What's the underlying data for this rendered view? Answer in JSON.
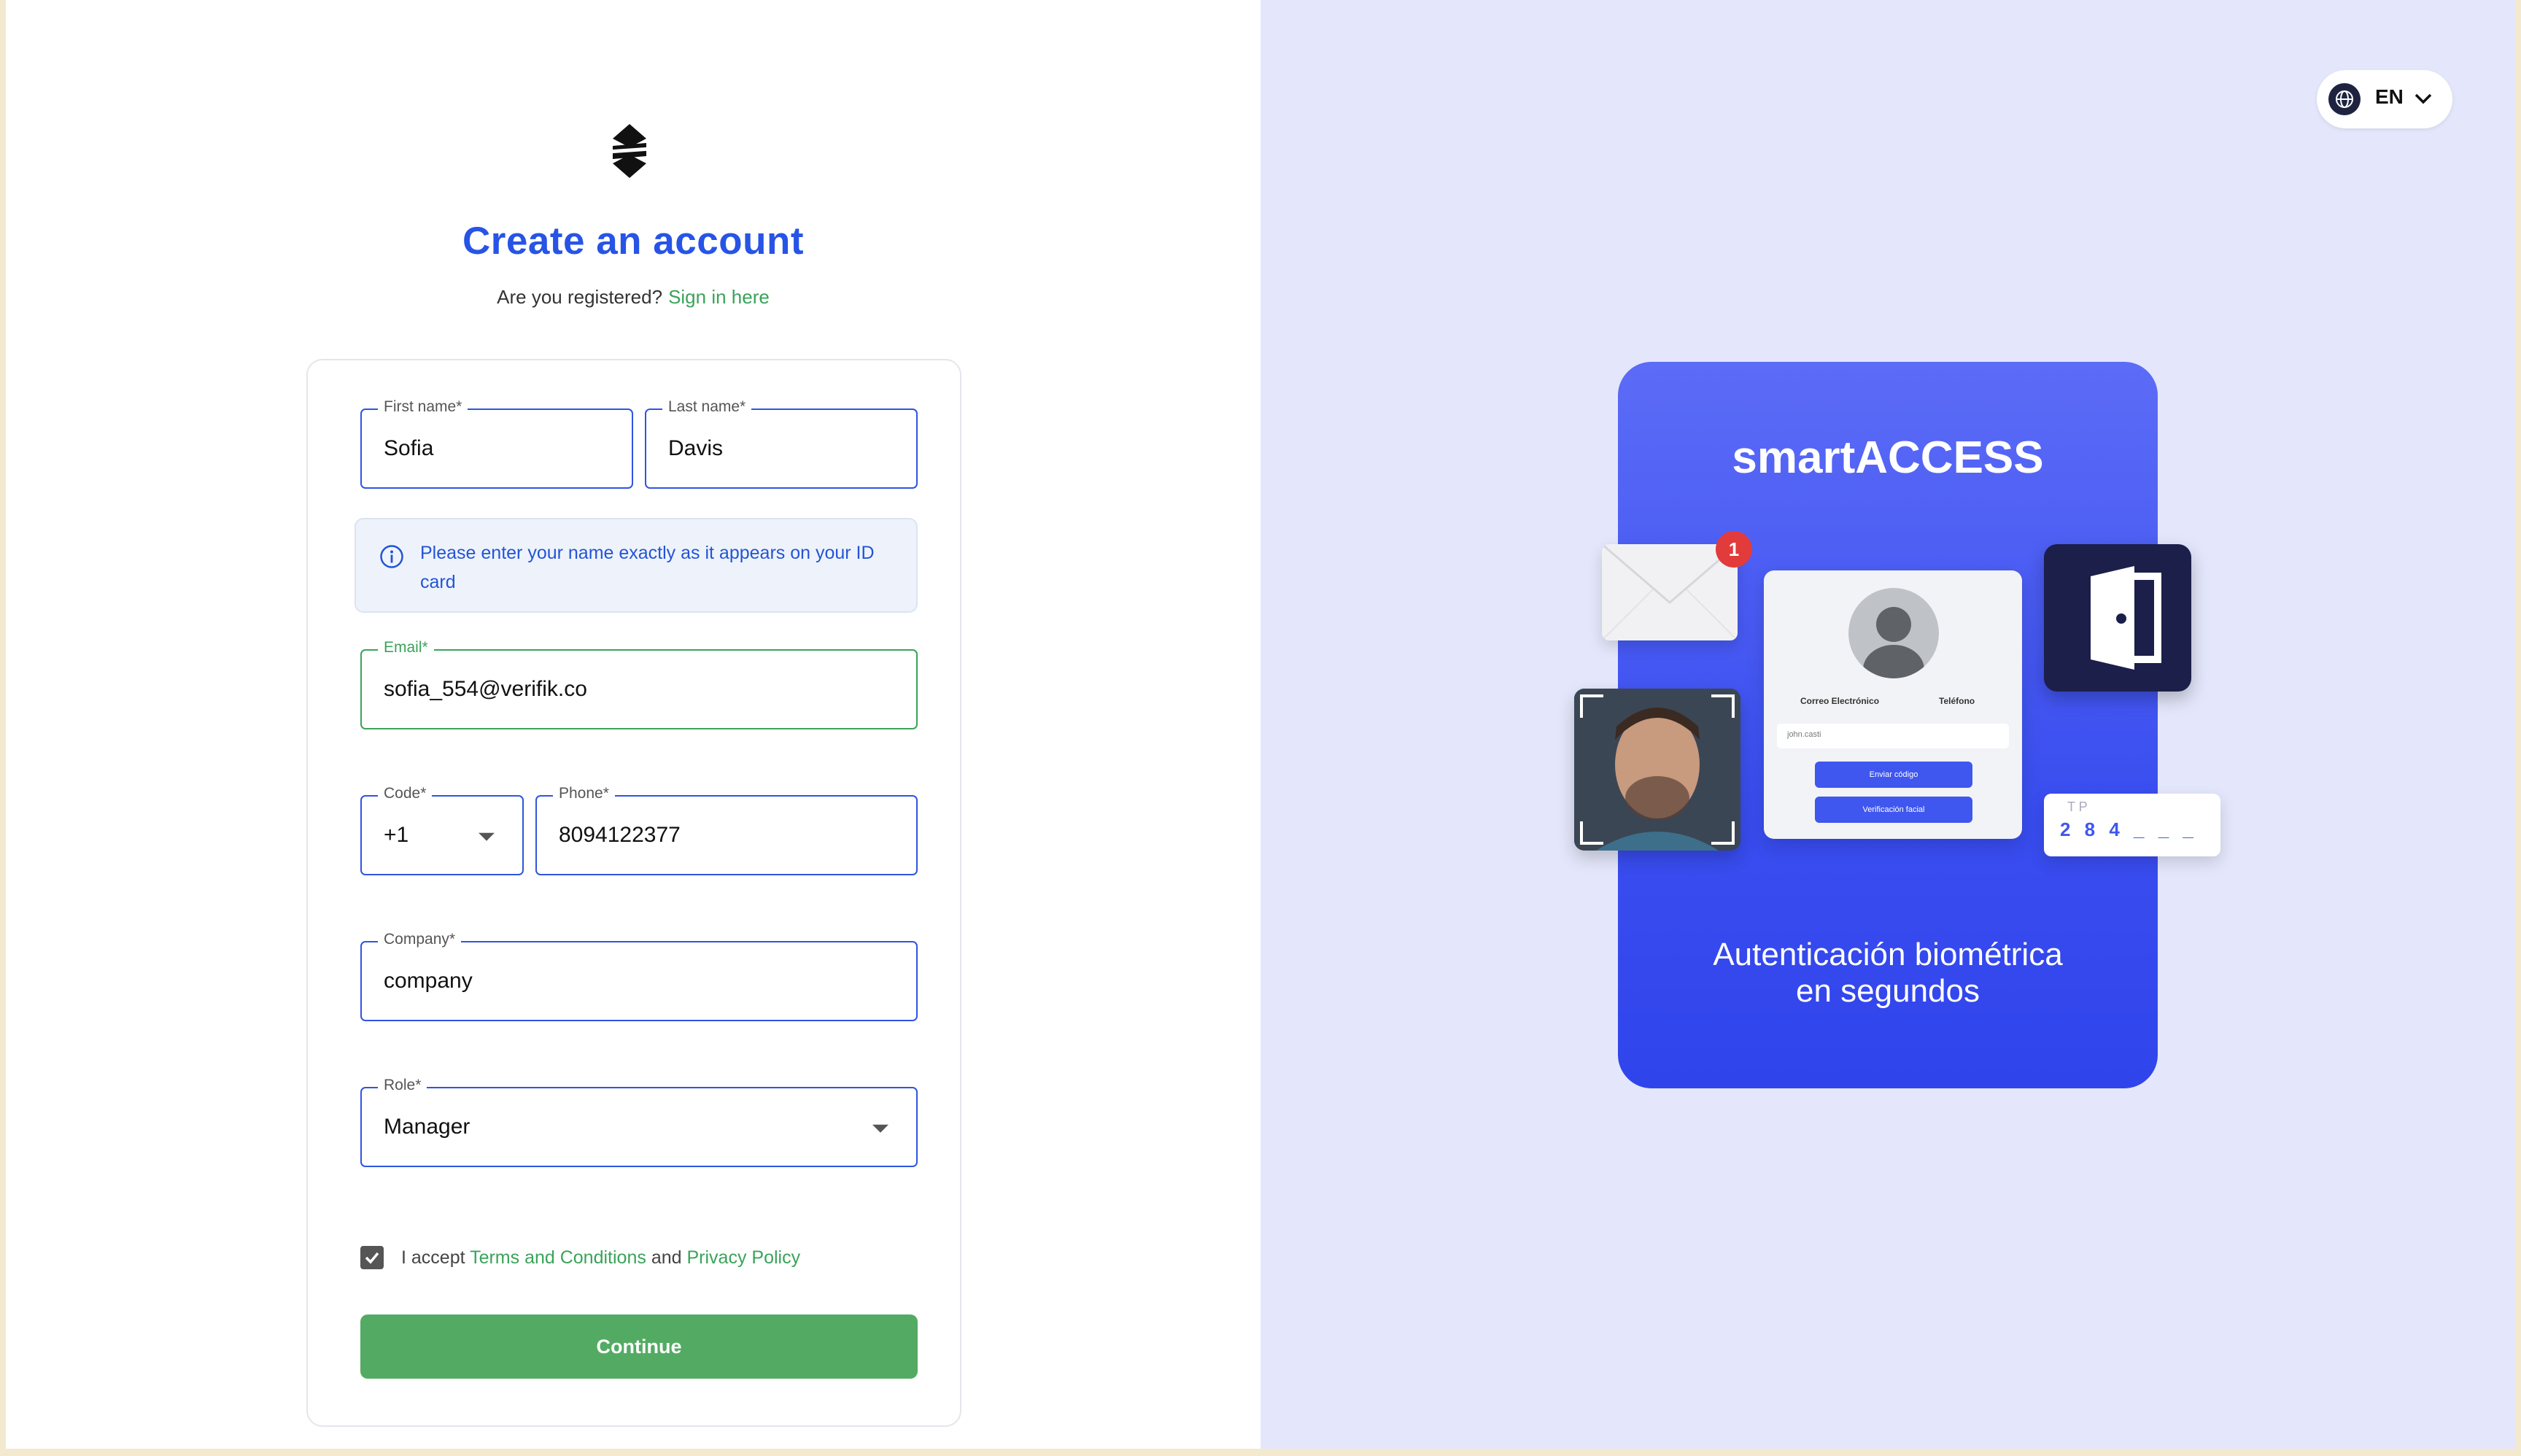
{
  "header": {
    "title": "Create an account",
    "registered_prompt": "Are you registered?",
    "sign_in_link": "Sign in here"
  },
  "form": {
    "first_name": {
      "label": "First name*",
      "value": "Sofia"
    },
    "last_name": {
      "label": "Last name*",
      "value": "Davis"
    },
    "info_text": "Please enter your name exactly as it appears on your ID card",
    "email": {
      "label": "Email*",
      "value": "sofia_554@verifik.co"
    },
    "code": {
      "label": "Code*",
      "value": "+1"
    },
    "phone": {
      "label": "Phone*",
      "value": "8094122377"
    },
    "company": {
      "label": "Company*",
      "value": "company"
    },
    "role": {
      "label": "Role*",
      "value": "Manager"
    },
    "terms": {
      "checked": true,
      "prefix": "I accept",
      "terms_link": "Terms and Conditions",
      "and_text": "and",
      "privacy_link": "Privacy Policy"
    },
    "continue_label": "Continue"
  },
  "language": {
    "code": "EN"
  },
  "promo": {
    "brand": "smartACCESS",
    "tagline_line1": "Autenticación biométrica",
    "tagline_line2": "en segundos",
    "notification_count": "1",
    "mock_email_label": "Correo Electrónico",
    "mock_phone_label": "Teléfono",
    "mock_input_value": "john.casti",
    "mock_send_code": "Enviar código",
    "mock_face_verify": "Verificación facial",
    "otp_digits": "2 8 4 _ _ _",
    "otp_top": "T P"
  },
  "colors": {
    "accent_blue": "#2754e6",
    "link_green": "#3aa35a",
    "button_green": "#53ab63",
    "right_bg": "#e4e7fb",
    "promo_blue": "#3a4ef0"
  }
}
